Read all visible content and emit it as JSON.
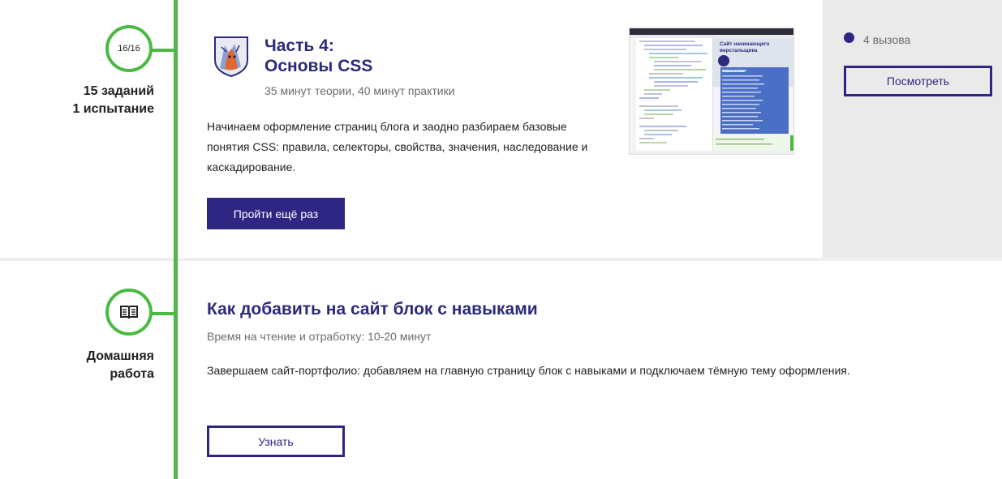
{
  "part4": {
    "progress": "16/16",
    "tasks_line1": "15 заданий",
    "tasks_line2": "1 испытание",
    "title_line1": "Часть 4:",
    "title_line2": "Основы CSS",
    "duration": "35 минут теории, 40 минут практики",
    "description": "Начинаем оформление страниц блога и заодно разбираем базовые понятия CSS: правила, селекторы, свойства, значения, наследование и каскадирование.",
    "button_label": "Пройти ещё раз",
    "preview": {
      "heading": "Сайт начинающего верстальщика",
      "list_title": "Записи в блоге"
    },
    "challenges": {
      "label": "4 вызова",
      "button_label": "Посмотреть"
    }
  },
  "homework": {
    "caption_line1": "Домашняя",
    "caption_line2": "работа",
    "icon": "book-icon",
    "title": "Как добавить на сайт блок с навыками",
    "duration": "Время на чтение и отработку: 10-20 минут",
    "description": "Завершаем сайт-портфолио: добавляем на главную страницу блок с навыками и подключаем тёмную тему оформления.",
    "button_label": "Узнать"
  },
  "colors": {
    "accent": "#2e2682",
    "timeline": "#4cb944",
    "title": "#2b2a7c",
    "panel": "#eaeaea"
  }
}
